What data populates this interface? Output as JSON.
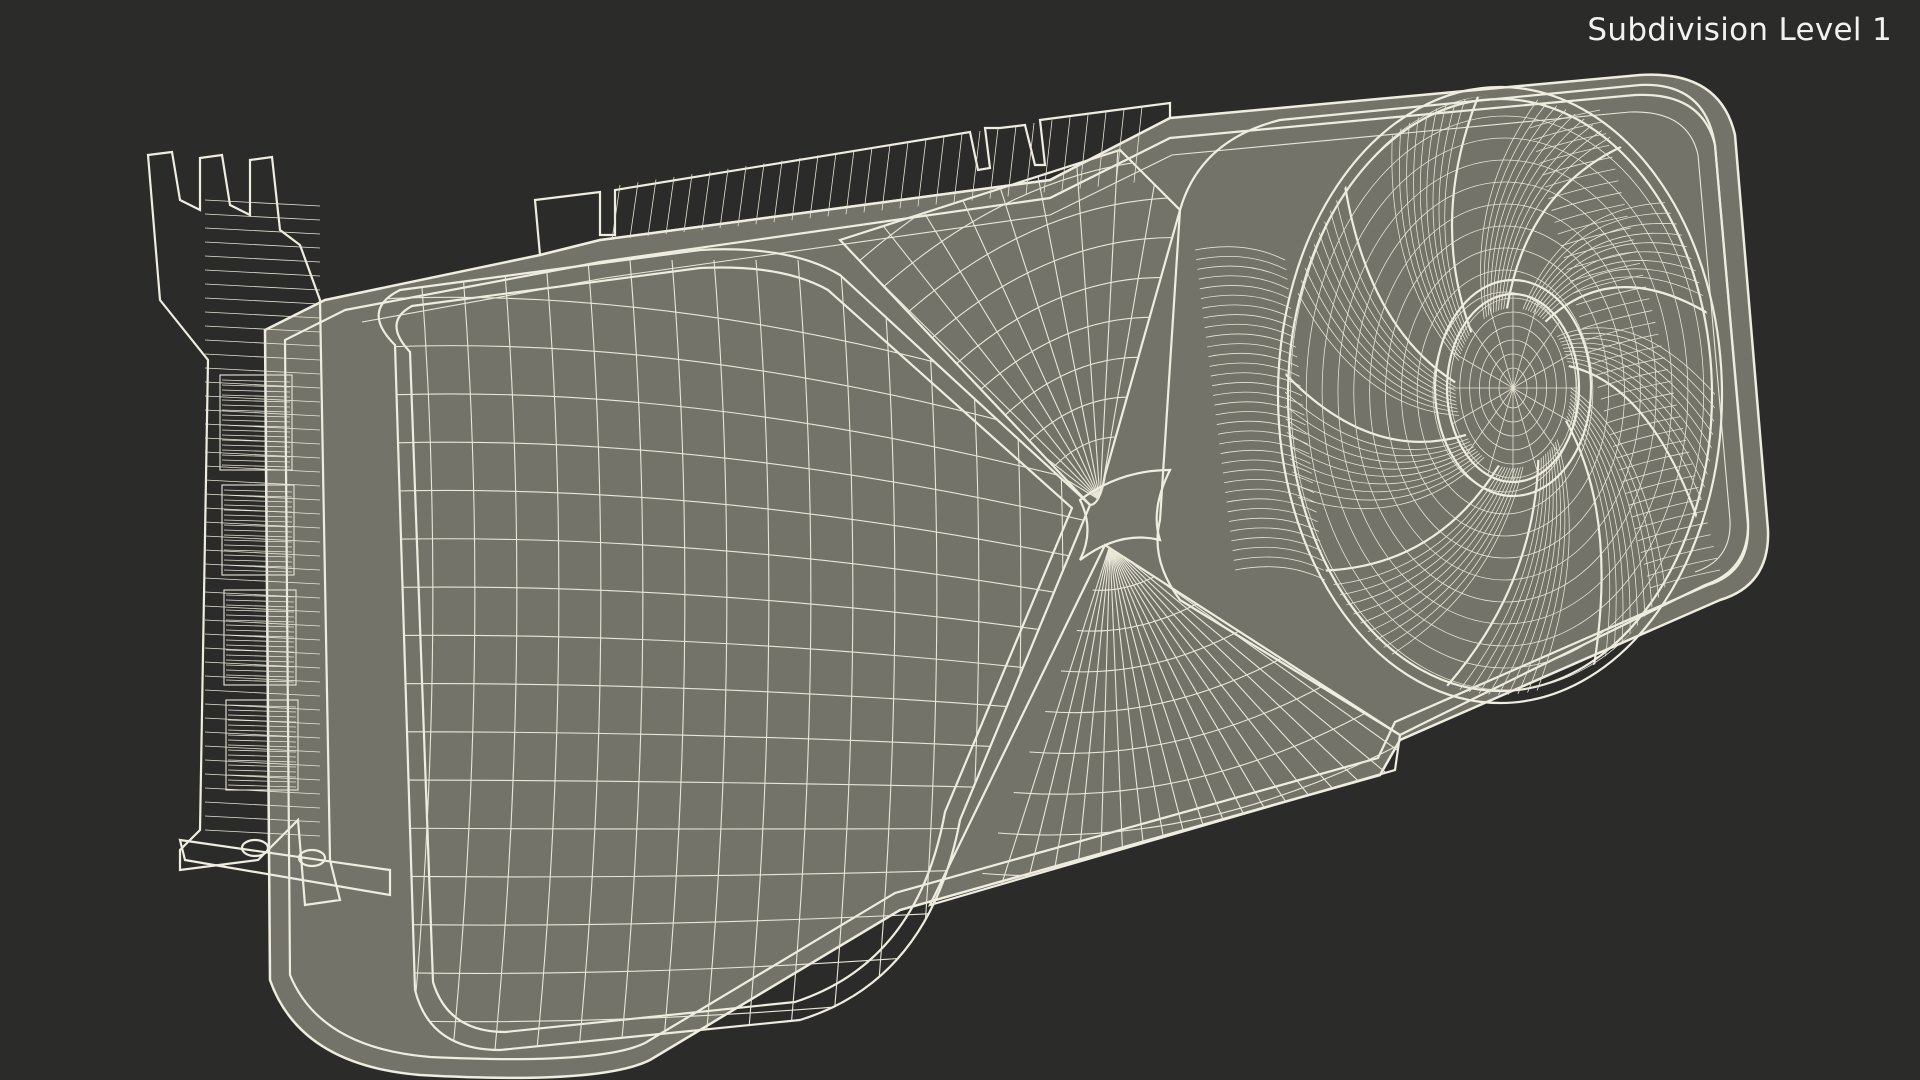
{
  "viewport": {
    "caption": "Subdivision Level 1",
    "background_color": "#2b2b2a",
    "wire_color": "#e9e7d8",
    "surface_color": "#7b7a6e"
  },
  "model": {
    "subject": "graphics-card-wireframe"
  }
}
